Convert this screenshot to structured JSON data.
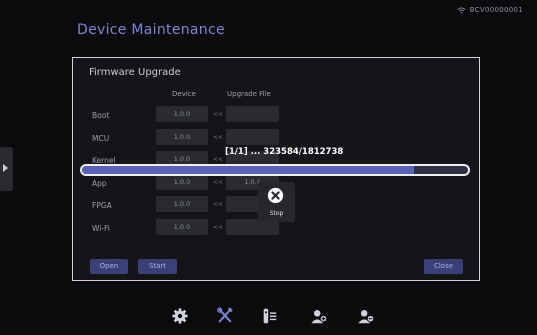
{
  "status": {
    "device_id": "BCV00000001"
  },
  "page": {
    "title": "Device Maintenance"
  },
  "panel": {
    "title": "Firmware Upgrade",
    "headers": {
      "device": "Device",
      "upgrade_file": "Upgrade File"
    },
    "rows": [
      {
        "label": "Boot",
        "device": "1.0.0",
        "arrow": "<<",
        "file": ""
      },
      {
        "label": "MCU",
        "device": "1.0.0",
        "arrow": "<<",
        "file": ""
      },
      {
        "label": "Kernel",
        "device": "1.0.0",
        "arrow": "<<",
        "file": ""
      },
      {
        "label": "App",
        "device": "1.0.0",
        "arrow": "<<",
        "file": "1.0.1"
      },
      {
        "label": "FPGA",
        "device": "1.0.0",
        "arrow": "<<",
        "file": ""
      },
      {
        "label": "Wi-Fi",
        "device": "1.0.0",
        "arrow": "<<",
        "file": ""
      }
    ],
    "buttons": {
      "open": "Open",
      "start": "Start",
      "close": "Close"
    }
  },
  "progress": {
    "text": "[1/1] ... 323584/1812738",
    "fraction": 0.86
  },
  "stop": {
    "label": "Stop"
  },
  "dock": {
    "icons": [
      "gear-icon",
      "tools-icon",
      "device-list-icon",
      "add-user-icon",
      "remove-user-icon"
    ]
  },
  "colors": {
    "accent": "#7e86d6",
    "button": "#3a3f78",
    "progress_fill": "#5a64b4",
    "background": "#0b0b0d"
  }
}
